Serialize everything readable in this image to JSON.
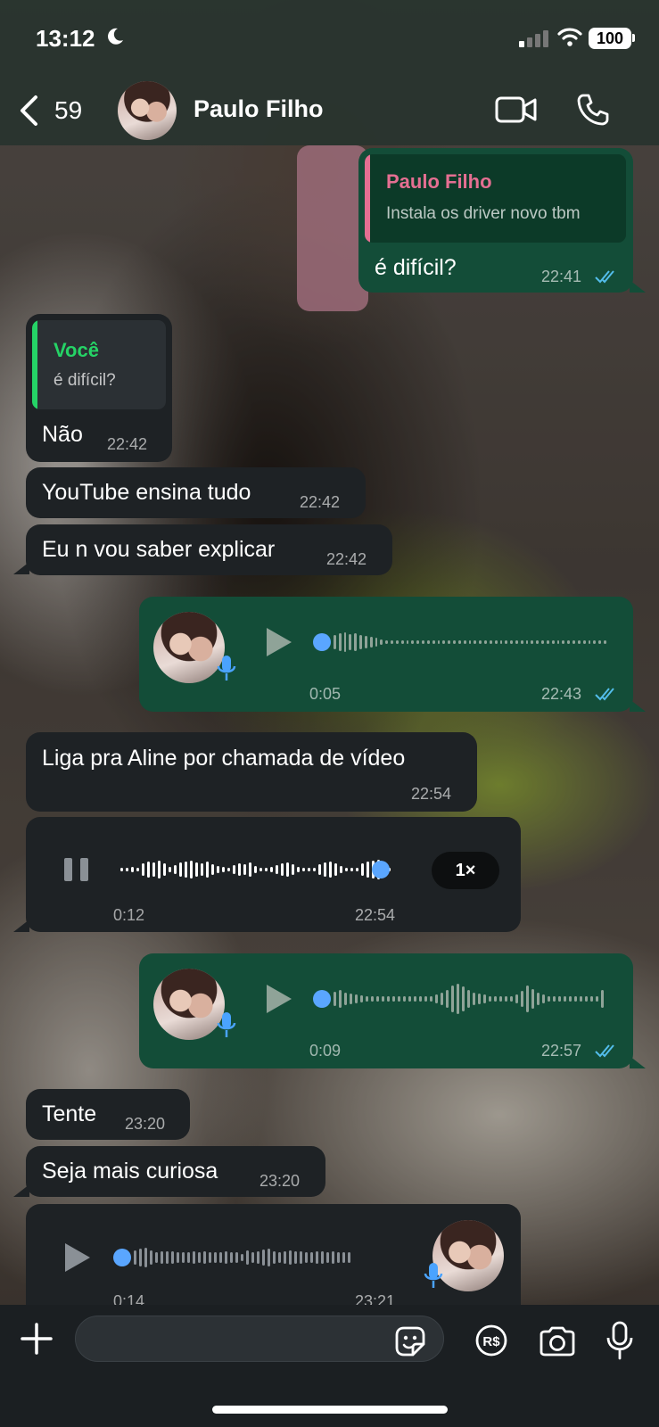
{
  "status_bar": {
    "time": "13:12",
    "battery": "100"
  },
  "header": {
    "back_count": "59",
    "contact_name": "Paulo Filho"
  },
  "messages": {
    "m1": {
      "quote_name": "Paulo Filho",
      "quote_text": "Instala os driver novo tbm",
      "text": "é difícil?",
      "time": "22:41"
    },
    "m2": {
      "quote_name": "Você",
      "quote_text": "é difícil?",
      "text": "Não",
      "time": "22:42"
    },
    "m3": {
      "text": "YouTube ensina tudo",
      "time": "22:42"
    },
    "m4": {
      "text": "Eu n vou saber explicar",
      "time": "22:42"
    },
    "v1": {
      "duration": "0:05",
      "time": "22:43"
    },
    "m5": {
      "text": "Liga pra Aline por chamada de vídeo",
      "time": "22:54"
    },
    "v2": {
      "duration": "0:12",
      "time": "22:54",
      "speed": "1×"
    },
    "v3": {
      "duration": "0:09",
      "time": "22:57"
    },
    "m6": {
      "text": "Tente",
      "time": "23:20"
    },
    "m7": {
      "text": "Seja mais curiosa",
      "time": "23:20"
    },
    "v4": {
      "duration": "0:14",
      "time": "23:21"
    }
  },
  "colors": {
    "outgoing_bubble": "#134d38",
    "incoming_bubble": "#1e2225",
    "read_ticks": "#53bdeb",
    "voice_dot": "#5aa6ff",
    "quote_pink": "#e56f92",
    "quote_green": "#25d366"
  },
  "icons": [
    "moon-icon",
    "signal-icon",
    "wifi-icon",
    "back-icon",
    "video-call-icon",
    "phone-call-icon",
    "play-icon",
    "pause-icon",
    "mic-icon",
    "plus-icon",
    "sticker-icon",
    "real-currency-icon",
    "camera-icon"
  ]
}
